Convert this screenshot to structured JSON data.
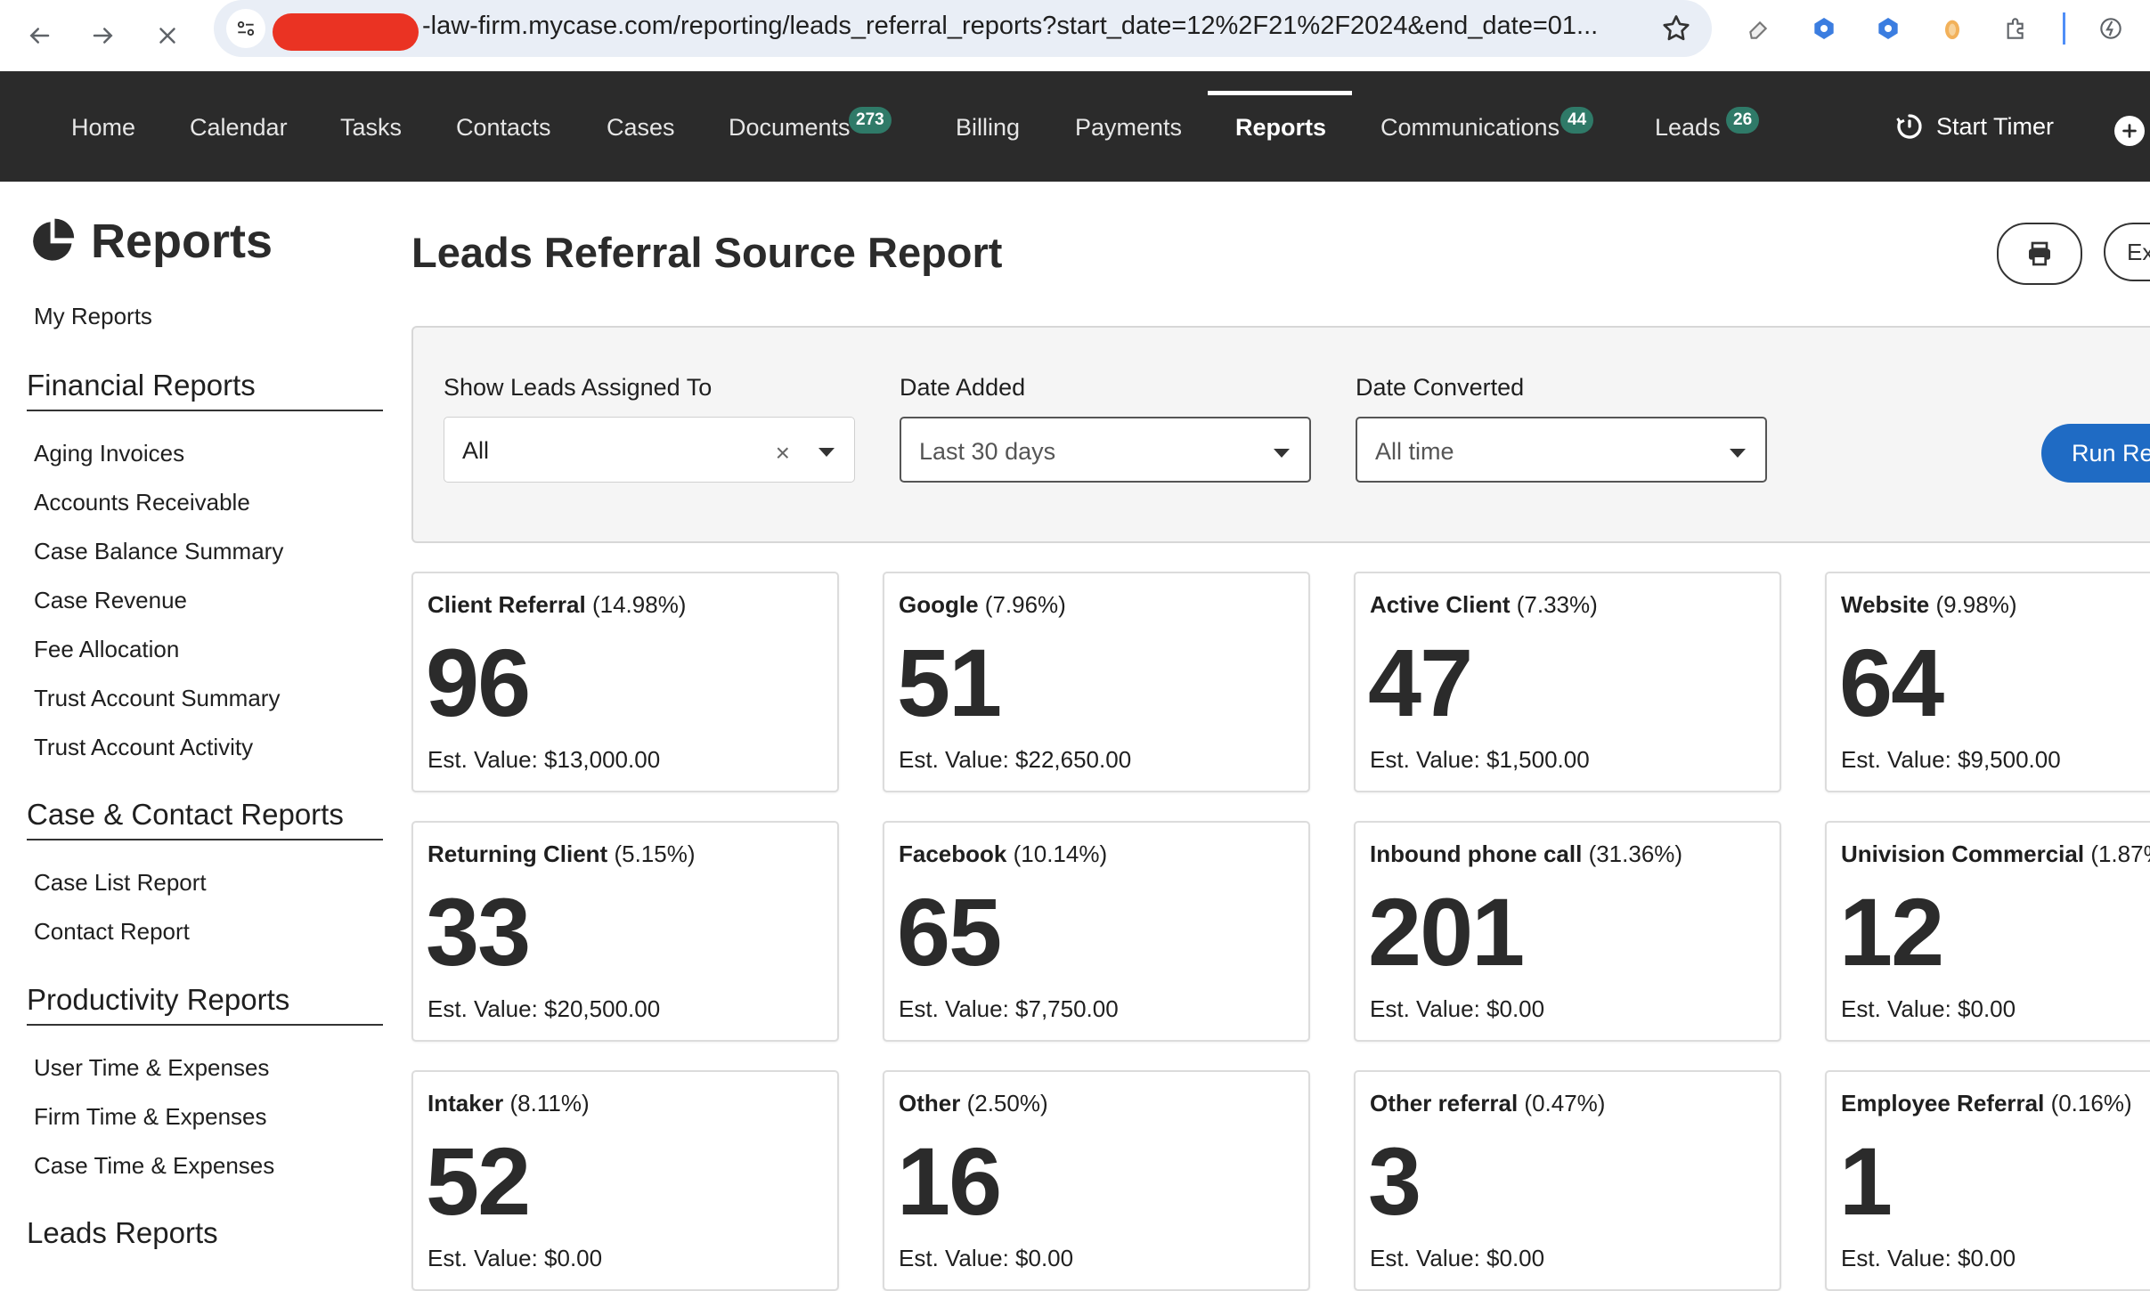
{
  "browser": {
    "url": "-law-firm.mycase.com/reporting/leads_referral_reports?start_date=12%2F21%2F2024&end_date=01..."
  },
  "nav": {
    "items": [
      {
        "label": "Home"
      },
      {
        "label": "Calendar"
      },
      {
        "label": "Tasks"
      },
      {
        "label": "Contacts"
      },
      {
        "label": "Cases"
      },
      {
        "label": "Documents",
        "badge": "273"
      },
      {
        "label": "Billing"
      },
      {
        "label": "Payments"
      },
      {
        "label": "Reports",
        "active": true
      },
      {
        "label": "Communications",
        "badge": "44"
      },
      {
        "label": "Leads",
        "badge": "26"
      }
    ],
    "start_timer": "Start Timer",
    "badge_color": "#2f7a68"
  },
  "sidebar": {
    "title": "Reports",
    "my_reports": "My Reports",
    "sections": [
      {
        "title": "Financial Reports",
        "items": [
          "Aging Invoices",
          "Accounts Receivable",
          "Case Balance Summary",
          "Case Revenue",
          "Fee Allocation",
          "Trust Account Summary",
          "Trust Account Activity"
        ]
      },
      {
        "title": "Case & Contact Reports",
        "items": [
          "Case List Report",
          "Contact Report"
        ]
      },
      {
        "title": "Productivity Reports",
        "items": [
          "User Time & Expenses",
          "Firm Time & Expenses",
          "Case Time & Expenses"
        ]
      },
      {
        "title": "Leads Reports",
        "items": []
      }
    ]
  },
  "main": {
    "title": "Leads Referral Source Report",
    "export_label": "Ex",
    "filters": {
      "assigned": {
        "label": "Show Leads Assigned To",
        "value": "All"
      },
      "date_added": {
        "label": "Date Added",
        "value": "Last 30 days"
      },
      "date_converted": {
        "label": "Date Converted",
        "value": "All time"
      },
      "run_label": "Run Re"
    },
    "cards": [
      {
        "source": "Client Referral",
        "pct": "(14.98%)",
        "count": "96",
        "est": "Est. Value: $13,000.00"
      },
      {
        "source": "Google",
        "pct": "(7.96%)",
        "count": "51",
        "est": "Est. Value: $22,650.00"
      },
      {
        "source": "Active Client",
        "pct": "(7.33%)",
        "count": "47",
        "est": "Est. Value: $1,500.00"
      },
      {
        "source": "Website",
        "pct": "(9.98%)",
        "count": "64",
        "est": "Est. Value: $9,500.00"
      },
      {
        "source": "Returning Client",
        "pct": "(5.15%)",
        "count": "33",
        "est": "Est. Value: $20,500.00"
      },
      {
        "source": "Facebook",
        "pct": "(10.14%)",
        "count": "65",
        "est": "Est. Value: $7,750.00"
      },
      {
        "source": "Inbound phone call",
        "pct": "(31.36%)",
        "count": "201",
        "est": "Est. Value: $0.00"
      },
      {
        "source": "Univision Commercial",
        "pct": "(1.87%",
        "count": "12",
        "est": "Est. Value: $0.00"
      },
      {
        "source": "Intaker",
        "pct": "(8.11%)",
        "count": "52",
        "est": "Est. Value: $0.00"
      },
      {
        "source": "Other",
        "pct": "(2.50%)",
        "count": "16",
        "est": "Est. Value: $0.00"
      },
      {
        "source": "Other referral",
        "pct": "(0.47%)",
        "count": "3",
        "est": "Est. Value: $0.00"
      },
      {
        "source": "Employee Referral",
        "pct": "(0.16%)",
        "count": "1",
        "est": "Est. Value: $0.00"
      }
    ]
  }
}
